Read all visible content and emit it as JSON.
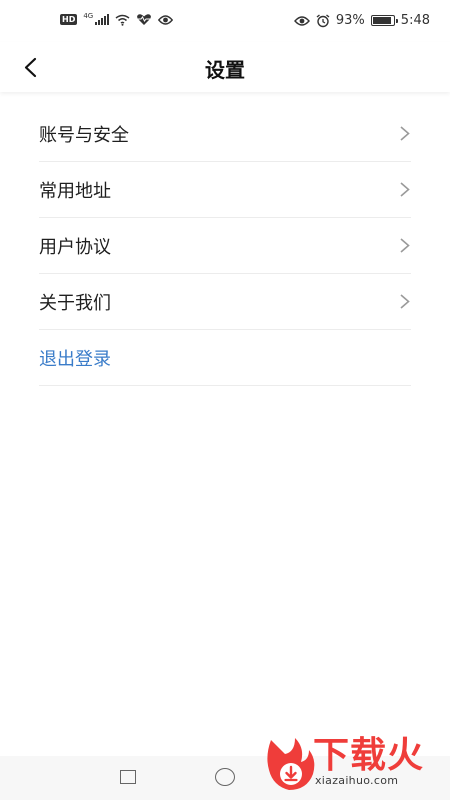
{
  "status_bar": {
    "hd": "HD",
    "network": "4G",
    "battery_percent": "93%",
    "battery_level": 0.93,
    "time": "5:48"
  },
  "header": {
    "title": "设置",
    "back_icon": "chevron-left-icon"
  },
  "settings_items": [
    {
      "label": "账号与安全",
      "icon": "chevron-right-icon"
    },
    {
      "label": "常用地址",
      "icon": "chevron-right-icon"
    },
    {
      "label": "用户协议",
      "icon": "chevron-right-icon"
    },
    {
      "label": "关于我们",
      "icon": "chevron-right-icon"
    }
  ],
  "logout": {
    "label": "退出登录"
  },
  "colors": {
    "logout_text": "#3a7cc9",
    "watermark_red": "#ef3d3a",
    "divider": "#ececec"
  },
  "watermark": {
    "brand": "下载火",
    "domain": "xiazaihuo.com"
  }
}
